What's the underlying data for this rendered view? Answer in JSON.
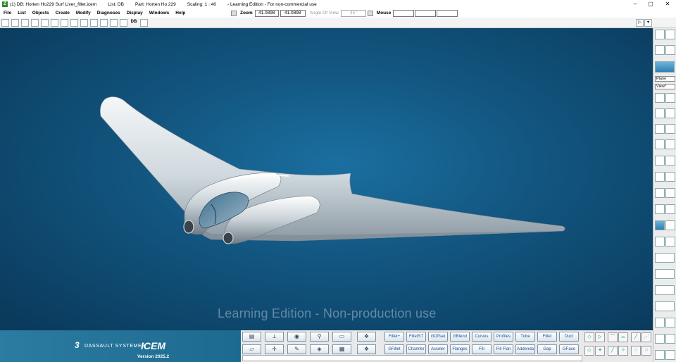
{
  "titlebar": {
    "app_icon": "Z",
    "db": "(1) DB: Horten Ho229 Surf Liver_fillet.icem",
    "list": "List: DB",
    "part": "Part: Horten Ho 229",
    "scaling": "Scaling: 1 : 40",
    "edition": "- Learning Edition - For non-commercial use",
    "minimize": "–",
    "maximize": "▢",
    "close": "✕"
  },
  "menu": [
    "File",
    "List",
    "Objects",
    "Create",
    "Modify",
    "Diagnoses",
    "Display",
    "Windows",
    "Help"
  ],
  "zoom": {
    "label": "Zoom",
    "value1": "41.0898",
    "value2": "41.0898",
    "angle_label": "Angle Of View",
    "angle_value": "45°",
    "mouse_label": "Mouse"
  },
  "toolbar": {
    "db_label": "DB",
    "right_arrow": "▷",
    "right_dropdown": "▾"
  },
  "viewport": {
    "watermark": "Learning Edition - Non-production use",
    "background_color": "#12557f"
  },
  "right_panel": {
    "select1": "Plane",
    "select2": "View*"
  },
  "brand": {
    "company": "DASSAULT SYSTEMES",
    "product": "ICEM",
    "version": "Version 2025.2"
  },
  "commands_row1": [
    "Fillet+",
    "FilletST",
    "GOffset",
    "GBlend",
    "Curves",
    "Profiles",
    "Tube",
    "Fillet",
    "Duct"
  ],
  "commands_row2": [
    "GFillet",
    "Chamfer",
    "Acceler",
    "Flanges",
    "Fill",
    "Fill Flan",
    "Addenda",
    "Gap",
    "GFace"
  ],
  "icons_row1": [
    "layers-icon",
    "axis-icon",
    "eye-icon",
    "hierarchy-icon",
    "window-icon"
  ],
  "icons_row2": [
    "folder-icon",
    "transform-icon",
    "pen-icon",
    "eraser-icon",
    "grid-icon"
  ],
  "colors": {
    "command_text": "#1f4f9c",
    "brand_bg": "#2c7ba1"
  }
}
